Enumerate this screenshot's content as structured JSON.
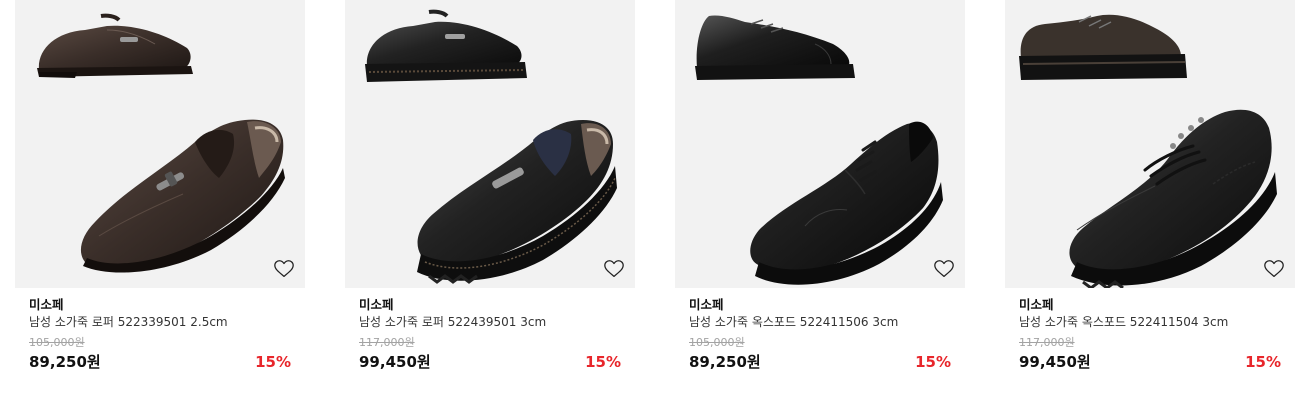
{
  "products": [
    {
      "brand": "미소페",
      "name": "남성 소가죽 로퍼 522339501 2.5cm",
      "original_price": "105,000원",
      "price": "89,250원",
      "discount": "15%",
      "shoe_color": "#3b2f2a",
      "style": "loafer",
      "wishlist_icon": "heart-outline-icon"
    },
    {
      "brand": "미소페",
      "name": "남성 소가죽 로퍼 522439501 3cm",
      "original_price": "117,000원",
      "price": "99,450원",
      "discount": "15%",
      "shoe_color": "#1e1e1e",
      "style": "lug-loafer",
      "wishlist_icon": "heart-outline-icon"
    },
    {
      "brand": "미소페",
      "name": "남성 소가죽 옥스포드 522411506 3cm",
      "original_price": "105,000원",
      "price": "89,250원",
      "discount": "15%",
      "shoe_color": "#181818",
      "style": "derby",
      "wishlist_icon": "heart-outline-icon"
    },
    {
      "brand": "미소페",
      "name": "남성 소가죽 옥스포드 522411504 3cm",
      "original_price": "117,000원",
      "price": "99,450원",
      "discount": "15%",
      "shoe_color": "#161616",
      "style": "moc-toe",
      "wishlist_icon": "heart-outline-icon"
    }
  ],
  "colors": {
    "thumb_bg": "#f2f2f2",
    "discount": "#e8262b",
    "original_price": "#a3a3a3"
  }
}
